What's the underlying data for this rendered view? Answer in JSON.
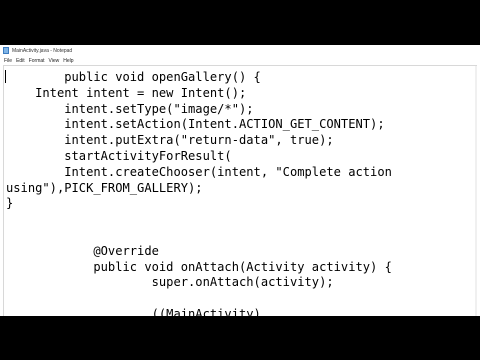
{
  "window": {
    "title": "MainActivity.java - Notepad"
  },
  "menu": [
    "File",
    "Edit",
    "Format",
    "View",
    "Help"
  ],
  "code_lines": [
    "        public void openGallery() {",
    "    Intent intent = new Intent();",
    "        intent.setType(\"image/*\");",
    "        intent.setAction(Intent.ACTION_GET_CONTENT);",
    "        intent.putExtra(\"return-data\", true);",
    "        startActivityForResult(",
    "        Intent.createChooser(intent, \"Complete action",
    "using\"),PICK_FROM_GALLERY);",
    "}",
    "",
    "",
    "            @Override",
    "            public void onAttach(Activity activity) {",
    "                    super.onAttach(activity);",
    "",
    "                    ((MainActivity)"
  ]
}
